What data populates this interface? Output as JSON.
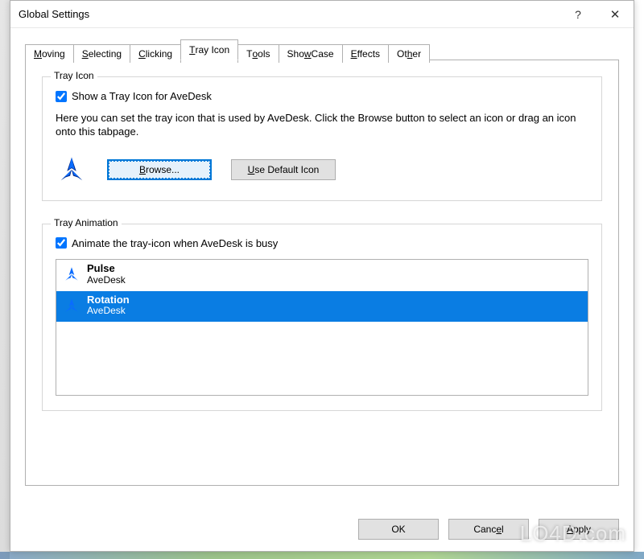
{
  "window": {
    "title": "Global Settings",
    "help_glyph": "?",
    "close_glyph": "✕"
  },
  "tabs": [
    {
      "label_pre": "",
      "accel": "M",
      "label_post": "oving"
    },
    {
      "label_pre": "",
      "accel": "S",
      "label_post": "electing"
    },
    {
      "label_pre": "",
      "accel": "C",
      "label_post": "licking"
    },
    {
      "label_pre": "",
      "accel": "T",
      "label_post": "ray Icon"
    },
    {
      "label_pre": "T",
      "accel": "o",
      "label_post": "ols"
    },
    {
      "label_pre": "Sho",
      "accel": "w",
      "label_post": "Case"
    },
    {
      "label_pre": "",
      "accel": "E",
      "label_post": "ffects"
    },
    {
      "label_pre": "Ot",
      "accel": "h",
      "label_post": "er"
    }
  ],
  "active_tab_index": 3,
  "tray_icon_group": {
    "legend": "Tray Icon",
    "checkbox_label": "Show a Tray Icon for AveDesk",
    "checkbox_checked": true,
    "description": "Here you can set the tray icon that is used by AveDesk. Click the Browse button to select an icon or drag an icon onto this tabpage.",
    "browse_pre": "",
    "browse_accel": "B",
    "browse_post": "rowse...",
    "default_pre": "",
    "default_accel": "U",
    "default_post": "se Default Icon"
  },
  "tray_anim_group": {
    "legend": "Tray Animation",
    "checkbox_label": "Animate the tray-icon when AveDesk is busy",
    "checkbox_checked": true,
    "items": [
      {
        "title": "Pulse",
        "sub": "AveDesk",
        "selected": false
      },
      {
        "title": "Rotation",
        "sub": "AveDesk",
        "selected": true
      }
    ]
  },
  "dialog_buttons": {
    "ok": "OK",
    "cancel_pre": "Canc",
    "cancel_accel": "e",
    "cancel_post": "l",
    "apply_pre": "",
    "apply_accel": "A",
    "apply_post": "pply"
  },
  "watermark": "LO4D.com"
}
